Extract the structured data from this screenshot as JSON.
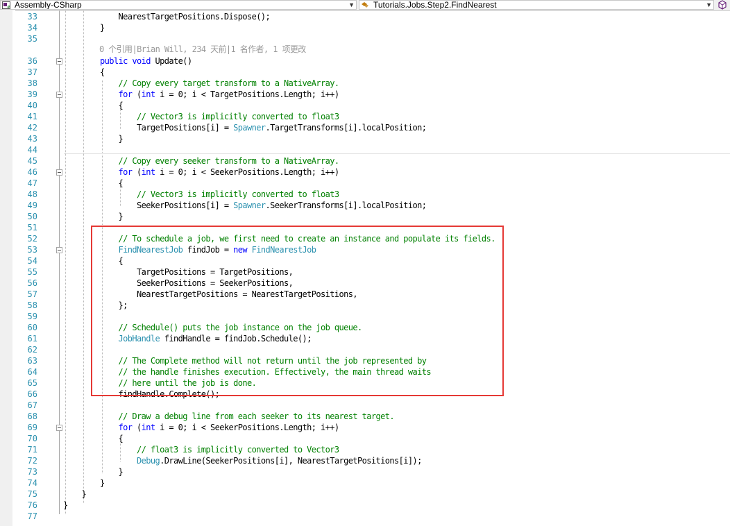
{
  "navbar": {
    "project_dropdown": "Assembly-CSharp",
    "type_dropdown": "Tutorials.Jobs.Step2.FindNearest"
  },
  "codelens": {
    "line": "36",
    "text": "0 个引用|Brian Will, 234 天前|1 名作者, 1 项更改"
  },
  "colors": {
    "comment": "#008000",
    "keyword": "#0000ff",
    "type": "#2b91af",
    "line_number": "#2b91af",
    "highlight_border": "#e53935"
  },
  "lines": [
    {
      "n": "33",
      "tokens": [
        {
          "t": "            NearestTargetPositions.Dispose();"
        }
      ]
    },
    {
      "n": "34",
      "tokens": [
        {
          "t": "        }"
        }
      ]
    },
    {
      "n": "35",
      "tokens": [
        {
          "t": ""
        }
      ]
    },
    {
      "n": "36",
      "tokens": [
        {
          "t": "        "
        },
        {
          "t": "public",
          "c": "k"
        },
        {
          "t": " "
        },
        {
          "t": "void",
          "c": "k"
        },
        {
          "t": " Update()"
        }
      ]
    },
    {
      "n": "37",
      "tokens": [
        {
          "t": "        {"
        }
      ]
    },
    {
      "n": "38",
      "tokens": [
        {
          "t": "            "
        },
        {
          "t": "// Copy every target transform to a NativeArray.",
          "c": "c"
        }
      ]
    },
    {
      "n": "39",
      "tokens": [
        {
          "t": "            "
        },
        {
          "t": "for",
          "c": "k"
        },
        {
          "t": " ("
        },
        {
          "t": "int",
          "c": "k"
        },
        {
          "t": " i = 0; i < TargetPositions.Length; i++)"
        }
      ]
    },
    {
      "n": "40",
      "tokens": [
        {
          "t": "            {"
        }
      ]
    },
    {
      "n": "41",
      "tokens": [
        {
          "t": "                "
        },
        {
          "t": "// Vector3 is implicitly converted to float3",
          "c": "c"
        }
      ]
    },
    {
      "n": "42",
      "tokens": [
        {
          "t": "                TargetPositions[i] = "
        },
        {
          "t": "Spawner",
          "c": "t"
        },
        {
          "t": ".TargetTransforms[i].localPosition;"
        }
      ]
    },
    {
      "n": "43",
      "tokens": [
        {
          "t": "            }"
        }
      ]
    },
    {
      "n": "44",
      "tokens": [
        {
          "t": ""
        }
      ]
    },
    {
      "n": "45",
      "tokens": [
        {
          "t": "            "
        },
        {
          "t": "// Copy every seeker transform to a NativeArray.",
          "c": "c"
        }
      ]
    },
    {
      "n": "46",
      "tokens": [
        {
          "t": "            "
        },
        {
          "t": "for",
          "c": "k"
        },
        {
          "t": " ("
        },
        {
          "t": "int",
          "c": "k"
        },
        {
          "t": " i = 0; i < SeekerPositions.Length; i++)"
        }
      ]
    },
    {
      "n": "47",
      "tokens": [
        {
          "t": "            {"
        }
      ]
    },
    {
      "n": "48",
      "tokens": [
        {
          "t": "                "
        },
        {
          "t": "// Vector3 is implicitly converted to float3",
          "c": "c"
        }
      ]
    },
    {
      "n": "49",
      "tokens": [
        {
          "t": "                SeekerPositions[i] = "
        },
        {
          "t": "Spawner",
          "c": "t"
        },
        {
          "t": ".SeekerTransforms[i].localPosition;"
        }
      ]
    },
    {
      "n": "50",
      "tokens": [
        {
          "t": "            }"
        }
      ]
    },
    {
      "n": "51",
      "tokens": [
        {
          "t": ""
        }
      ]
    },
    {
      "n": "52",
      "tokens": [
        {
          "t": "            "
        },
        {
          "t": "// To schedule a job, we first need to create an instance and populate its fields.",
          "c": "c"
        }
      ]
    },
    {
      "n": "53",
      "tokens": [
        {
          "t": "            "
        },
        {
          "t": "FindNearestJob",
          "c": "t"
        },
        {
          "t": " findJob = "
        },
        {
          "t": "new",
          "c": "k"
        },
        {
          "t": " "
        },
        {
          "t": "FindNearestJob",
          "c": "t"
        }
      ]
    },
    {
      "n": "54",
      "tokens": [
        {
          "t": "            {"
        }
      ]
    },
    {
      "n": "55",
      "tokens": [
        {
          "t": "                TargetPositions = TargetPositions,"
        }
      ]
    },
    {
      "n": "56",
      "tokens": [
        {
          "t": "                SeekerPositions = SeekerPositions,"
        }
      ]
    },
    {
      "n": "57",
      "tokens": [
        {
          "t": "                NearestTargetPositions = NearestTargetPositions,"
        }
      ]
    },
    {
      "n": "58",
      "tokens": [
        {
          "t": "            };"
        }
      ]
    },
    {
      "n": "59",
      "tokens": [
        {
          "t": ""
        }
      ]
    },
    {
      "n": "60",
      "tokens": [
        {
          "t": "            "
        },
        {
          "t": "// Schedule() puts the job instance on the job queue.",
          "c": "c"
        }
      ]
    },
    {
      "n": "61",
      "tokens": [
        {
          "t": "            "
        },
        {
          "t": "JobHandle",
          "c": "t"
        },
        {
          "t": " findHandle = findJob.Schedule();"
        }
      ]
    },
    {
      "n": "62",
      "tokens": [
        {
          "t": ""
        }
      ]
    },
    {
      "n": "63",
      "tokens": [
        {
          "t": "            "
        },
        {
          "t": "// The Complete method will not return until the job represented by",
          "c": "c"
        }
      ]
    },
    {
      "n": "64",
      "tokens": [
        {
          "t": "            "
        },
        {
          "t": "// the handle finishes execution. Effectively, the main thread waits",
          "c": "c"
        }
      ]
    },
    {
      "n": "65",
      "tokens": [
        {
          "t": "            "
        },
        {
          "t": "// here until the job is done.",
          "c": "c"
        }
      ]
    },
    {
      "n": "66",
      "tokens": [
        {
          "t": "            findHandle.Complete();"
        }
      ]
    },
    {
      "n": "67",
      "tokens": [
        {
          "t": ""
        }
      ]
    },
    {
      "n": "68",
      "tokens": [
        {
          "t": "            "
        },
        {
          "t": "// Draw a debug line from each seeker to its nearest target.",
          "c": "c"
        }
      ]
    },
    {
      "n": "69",
      "tokens": [
        {
          "t": "            "
        },
        {
          "t": "for",
          "c": "k"
        },
        {
          "t": " ("
        },
        {
          "t": "int",
          "c": "k"
        },
        {
          "t": " i = 0; i < SeekerPositions.Length; i++)"
        }
      ]
    },
    {
      "n": "70",
      "tokens": [
        {
          "t": "            {"
        }
      ]
    },
    {
      "n": "71",
      "tokens": [
        {
          "t": "                "
        },
        {
          "t": "// float3 is implicitly converted to Vector3",
          "c": "c"
        }
      ]
    },
    {
      "n": "72",
      "tokens": [
        {
          "t": "                "
        },
        {
          "t": "Debug",
          "c": "t"
        },
        {
          "t": ".DrawLine(SeekerPositions[i], NearestTargetPositions[i]);"
        }
      ]
    },
    {
      "n": "73",
      "tokens": [
        {
          "t": "            }"
        }
      ]
    },
    {
      "n": "74",
      "tokens": [
        {
          "t": "        }"
        }
      ]
    },
    {
      "n": "75",
      "tokens": [
        {
          "t": "    }"
        }
      ]
    },
    {
      "n": "76",
      "tokens": [
        {
          "t": "}"
        }
      ]
    },
    {
      "n": "77",
      "tokens": [
        {
          "t": ""
        }
      ]
    }
  ]
}
